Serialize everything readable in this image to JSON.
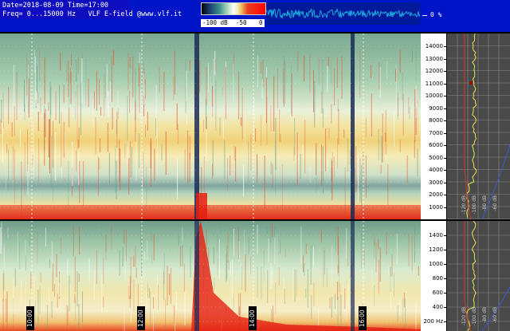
{
  "header": {
    "line1": "Date=2018-08-09 Time=17:00",
    "line2": "Freq= 0...15000 Hz   VLF E-field @www.vlf.it",
    "percent": "0 %"
  },
  "colorbar": {
    "labels": [
      "-100 dB",
      "-50",
      "0"
    ]
  },
  "upper_axis": {
    "ticks": [
      "14000",
      "13000",
      "12000",
      "11000",
      "10000",
      "9000",
      "8000",
      "7000",
      "6000",
      "5000",
      "4000",
      "3000",
      "2000",
      "1000"
    ]
  },
  "lower_axis": {
    "ticks": [
      "1400",
      "1200",
      "1000",
      "800",
      "600",
      "400",
      "200 Hz"
    ]
  },
  "time_labels": [
    "10:00",
    "12:00",
    "14:00",
    "16:00"
  ],
  "profile_db_labels": [
    "-120 dB",
    "-100 dB",
    "-80 dB",
    "-60 dB"
  ],
  "colors": {
    "header_bg": "#0014c8",
    "spectrogram_green": "#7fb98f",
    "spectrogram_yellow": "#f3e6a4",
    "spectrogram_red": "#e0281e",
    "profile_line": "#e8e84a"
  }
}
